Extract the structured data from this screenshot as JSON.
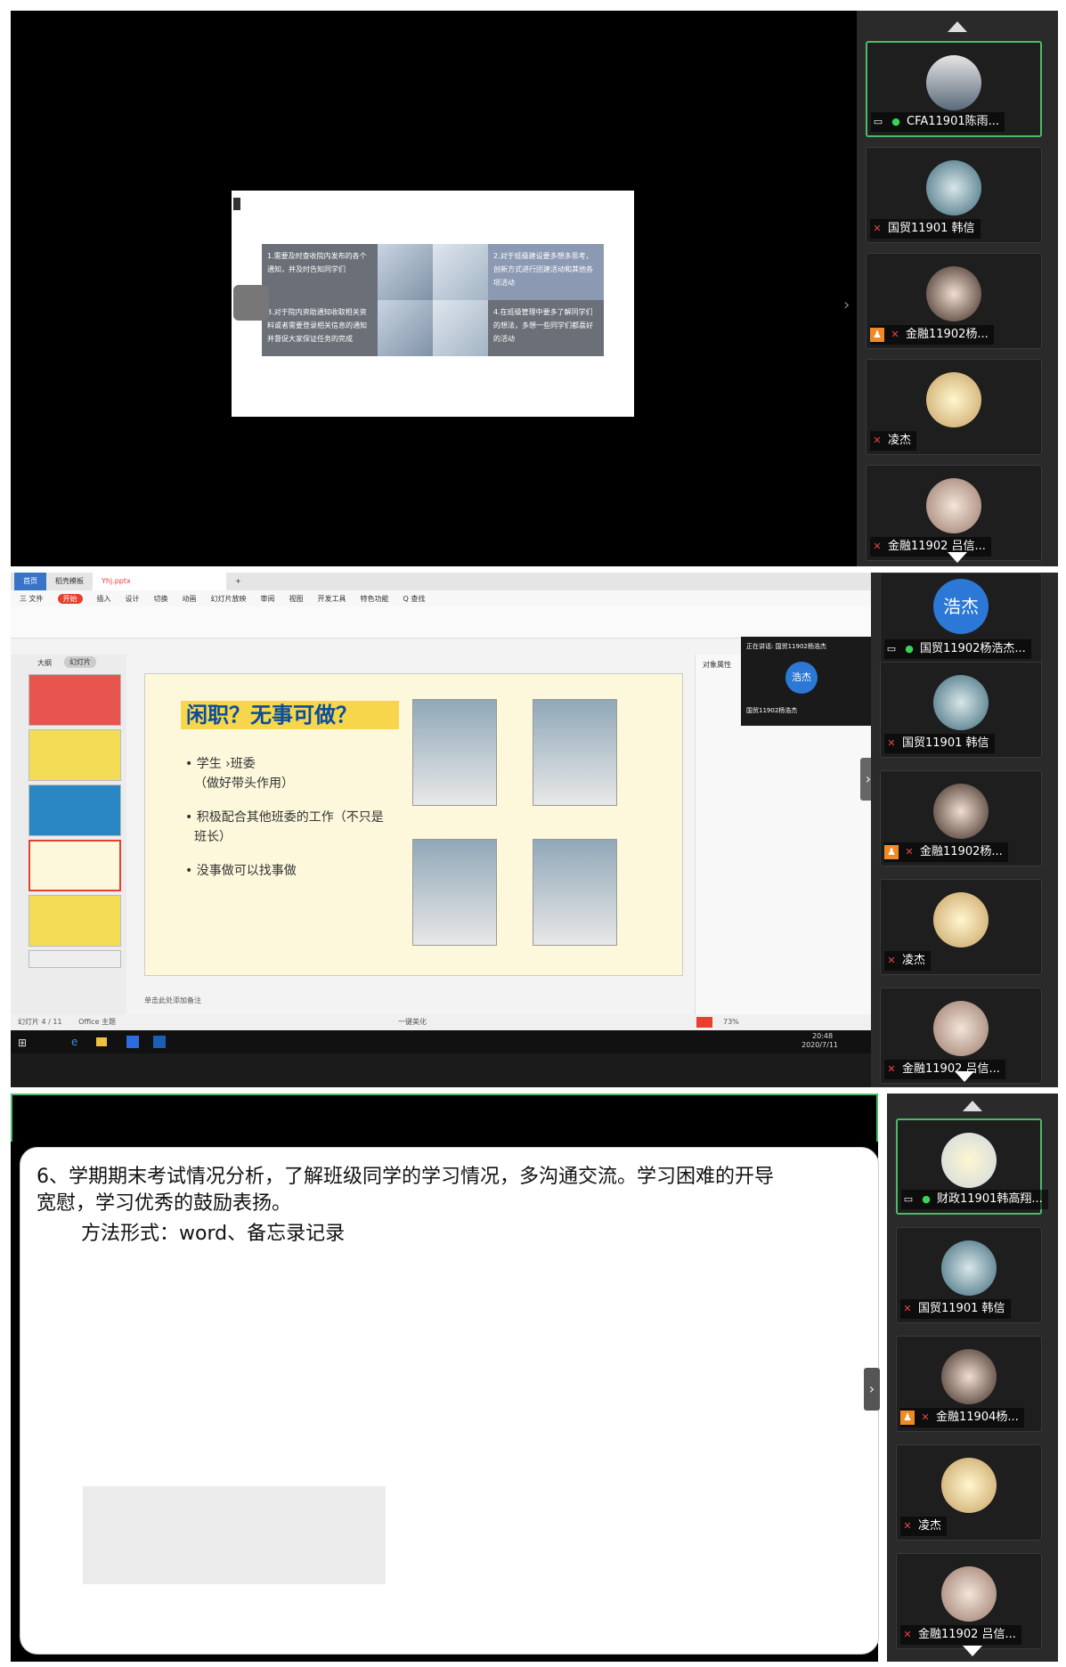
{
  "panel1": {
    "slide": {
      "cells": [
        "1.需要及时查收院内发布的各个通知，并及时告知同学们",
        "2.对于班级建设要多想多思考，创新方式进行团建活动和其他各项活动",
        "3.对于院内资助通知收取相关资料或者需要登录相关信息的通知并督促大家保证任务的完成",
        "4.在班级管理中要多了解同学们的想法，多想一些同学们都喜好的活动"
      ]
    },
    "participants": [
      {
        "name": "CFA11901陈雨...",
        "mic": "on",
        "active": true
      },
      {
        "name": "国贸11901 韩信",
        "mic": "off",
        "active": false
      },
      {
        "name": "金融11902杨...",
        "mic": "off",
        "active": false,
        "badge": true
      },
      {
        "name": "凌杰",
        "mic": "off",
        "active": false
      },
      {
        "name": "金融11902 吕信...",
        "mic": "off",
        "active": false
      }
    ]
  },
  "panel2": {
    "tabs": [
      "首页",
      "稻壳模板",
      "Yhj.pptx"
    ],
    "menu": [
      "三 文件",
      "开始",
      "插入",
      "设计",
      "切换",
      "动画",
      "幻灯片放映",
      "审阅",
      "视图",
      "开发工具",
      "特色功能",
      "Q 查找"
    ],
    "thumb_tabs": [
      "大纲",
      "幻灯片"
    ],
    "slide": {
      "title": "闲职？无事可做？",
      "bullets": [
        "• 学生 ›班委",
        "（做好带头作用）",
        "• 积极配合其他班委的工作（不只是",
        "班长）",
        "• 没事做可以找事做"
      ]
    },
    "notes_placeholder": "单击此处添加备注",
    "status_left": "幻灯片 4 / 11",
    "status_theme": "Office 主题",
    "status_mid": "一键美化",
    "zoom": "73%",
    "clock_time": "20:48",
    "clock_date": "2020/7/11",
    "popup_title": "正在讲话: 国贸11902杨浩杰",
    "popup_avatar": "浩杰",
    "popup_name": "国贸11902杨浩杰",
    "right_pane_title": "对象属性",
    "participants": [
      {
        "name": "国贸11902杨浩杰...",
        "mic": "on",
        "active": false,
        "text_avatar": "浩杰"
      },
      {
        "name": "国贸11901 韩信",
        "mic": "off",
        "active": false
      },
      {
        "name": "金融11902杨...",
        "mic": "off",
        "active": false,
        "badge": true
      },
      {
        "name": "凌杰",
        "mic": "off",
        "active": false
      },
      {
        "name": "金融11902 吕信...",
        "mic": "off",
        "active": false
      }
    ]
  },
  "panel3": {
    "doc": {
      "line1": "6、学期期末考试情况分析，了解班级同学的学习情况，多沟通交流。学习困难的开导",
      "line2": "宽慰，学习优秀的鼓励表扬。",
      "line3": "方法形式：word、备忘录记录"
    },
    "participants": [
      {
        "name": "财政11901韩高翔...",
        "mic": "on",
        "active": true
      },
      {
        "name": "国贸11901 韩信",
        "mic": "off",
        "active": false
      },
      {
        "name": "金融11904杨...",
        "mic": "off",
        "active": false,
        "badge": true
      },
      {
        "name": "凌杰",
        "mic": "off",
        "active": false
      },
      {
        "name": "金融11902 吕信...",
        "mic": "off",
        "active": false
      }
    ]
  },
  "colors": {
    "accent_green": "#4bbb6a",
    "blue_avatar": "#2b78d6",
    "wps_red": "#e6402f"
  }
}
